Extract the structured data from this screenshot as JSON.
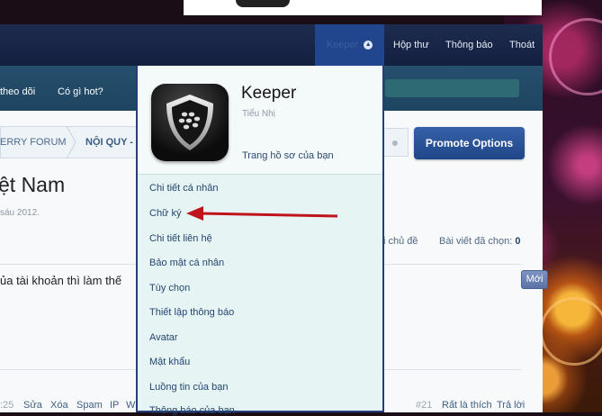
{
  "nav": {
    "active_label": "Keeper",
    "links": [
      "Hộp thư",
      "Thông báo",
      "Thoát"
    ]
  },
  "subnav": {
    "links": [
      "theo dõi",
      "Có gì hot?"
    ]
  },
  "breadcrumbs": [
    "ERRY FORUM",
    "NỘI QUY - T"
  ],
  "promote_label": "Promote Options",
  "thread": {
    "title": "ệt Nam",
    "date": "sáu 2012.",
    "stat_topic": "i chủ đề",
    "stat_selected_label": "Bài viết đã chọn:",
    "stat_selected_value": "0",
    "post_text": "ủa tài khoản thì làm thế",
    "new_badge": "Mới"
  },
  "post_footer": {
    "time": ":25",
    "actions": [
      "Sửa",
      "Xóa",
      "Spam",
      "IP",
      "W"
    ],
    "post_number": "#21",
    "like": "Rất là thích",
    "reply": "Trả lời"
  },
  "dropdown": {
    "username": "Keeper",
    "role": "Tiểu Nhị",
    "profile_link": "Trang hồ sơ của bạn",
    "items": [
      "Chi tiết cá nhân",
      "Chữ ký",
      "Chi tiết liên hệ",
      "Bảo mật cá nhân",
      "Tùy chọn",
      "Thiết lập thông báo",
      "Avatar",
      "Mật khẩu",
      "Luồng tin của bạn",
      "Thông báo của bạn"
    ]
  },
  "colors": {
    "nav_bg": "#1d2b4e",
    "nav_active": "#22468d",
    "subnav_bg": "#26506e",
    "dropdown_bg": "#e7f4f4",
    "annotation_arrow": "#c0141c"
  }
}
